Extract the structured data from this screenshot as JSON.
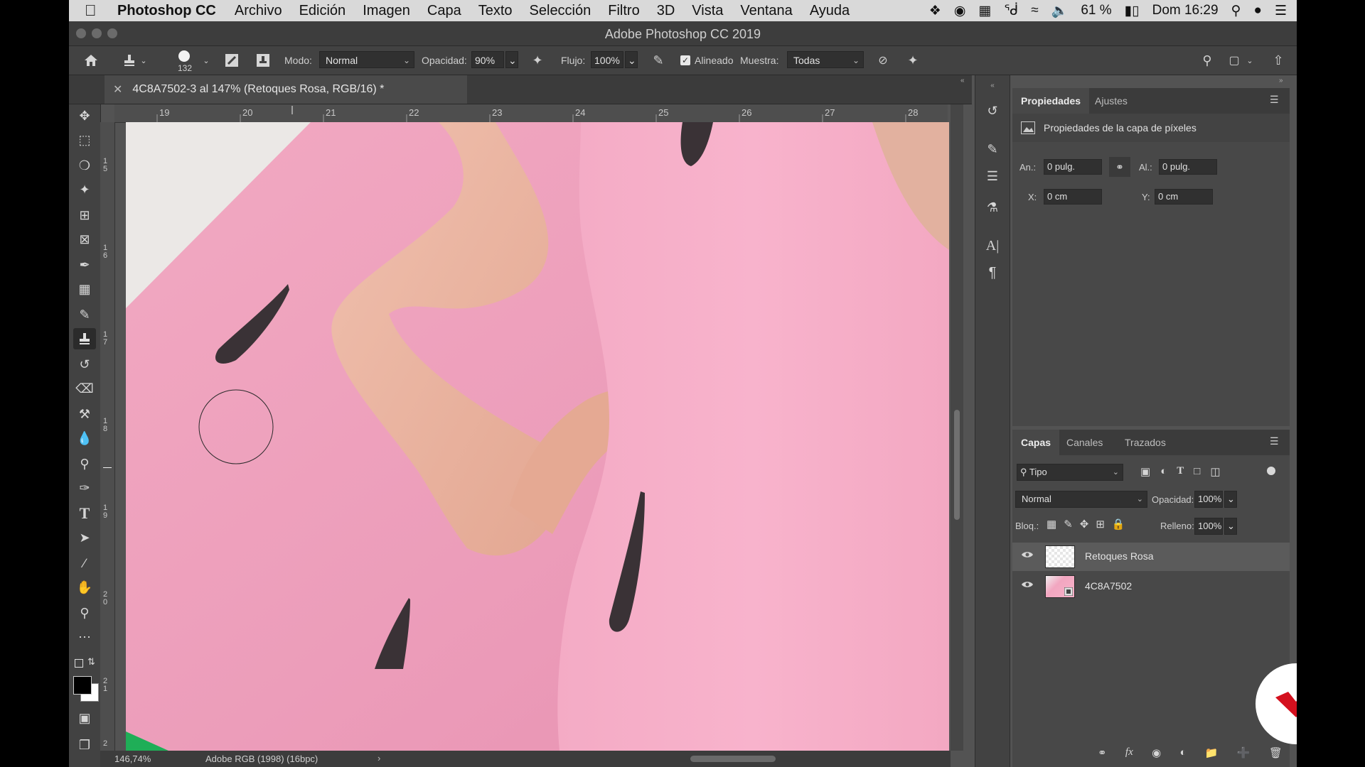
{
  "menubar": {
    "app": "Photoshop CC",
    "items": [
      "Archivo",
      "Edición",
      "Imagen",
      "Capa",
      "Texto",
      "Selección",
      "Filtro",
      "3D",
      "Vista",
      "Ventana",
      "Ayuda"
    ],
    "battery": "61 %",
    "clock": "Dom 16:29"
  },
  "window": {
    "title": "Adobe Photoshop CC 2019"
  },
  "options": {
    "brush_size": "132",
    "mode_label": "Modo:",
    "mode_value": "Normal",
    "opacity_label": "Opacidad:",
    "opacity_value": "90%",
    "flow_label": "Flujo:",
    "flow_value": "100%",
    "aligned_label": "Alineado",
    "sample_label": "Muestra:",
    "sample_value": "Todas"
  },
  "document": {
    "tab_title": "4C8A7502-3 al 147% (Retoques Rosa, RGB/16) *",
    "zoom": "146,74%",
    "profile": "Adobe RGB (1998) (16bpc)"
  },
  "rulers": {
    "top": [
      "19",
      "20",
      "21",
      "22",
      "23",
      "24",
      "25",
      "26",
      "27",
      "28"
    ],
    "left": [
      "1\n5",
      "1\n6",
      "1\n7",
      "1\n8",
      "1\n9",
      "2\n0",
      "2\n1",
      "2"
    ]
  },
  "properties": {
    "tabs": [
      "Propiedades",
      "Ajustes"
    ],
    "header": "Propiedades de la capa de píxeles",
    "w_label": "An.:",
    "w_value": "0 pulg.",
    "h_label": "Al.:",
    "h_value": "0 pulg.",
    "x_label": "X:",
    "x_value": "0 cm",
    "y_label": "Y:",
    "y_value": "0 cm"
  },
  "layers": {
    "tabs": [
      "Capas",
      "Canales",
      "Trazados"
    ],
    "filter_value": "Tipo",
    "blend_value": "Normal",
    "opacity_label": "Opacidad:",
    "opacity_value": "100%",
    "lock_label": "Bloq.:",
    "fill_label": "Relleno:",
    "fill_value": "100%",
    "items": [
      {
        "name": "Retoques Rosa"
      },
      {
        "name": "4C8A7502"
      }
    ]
  },
  "colors": {
    "pink_wall": "#f2a6c0",
    "dress": "#f5a9c3",
    "seed": "#3a3236",
    "brand_red": "#d4101e"
  }
}
